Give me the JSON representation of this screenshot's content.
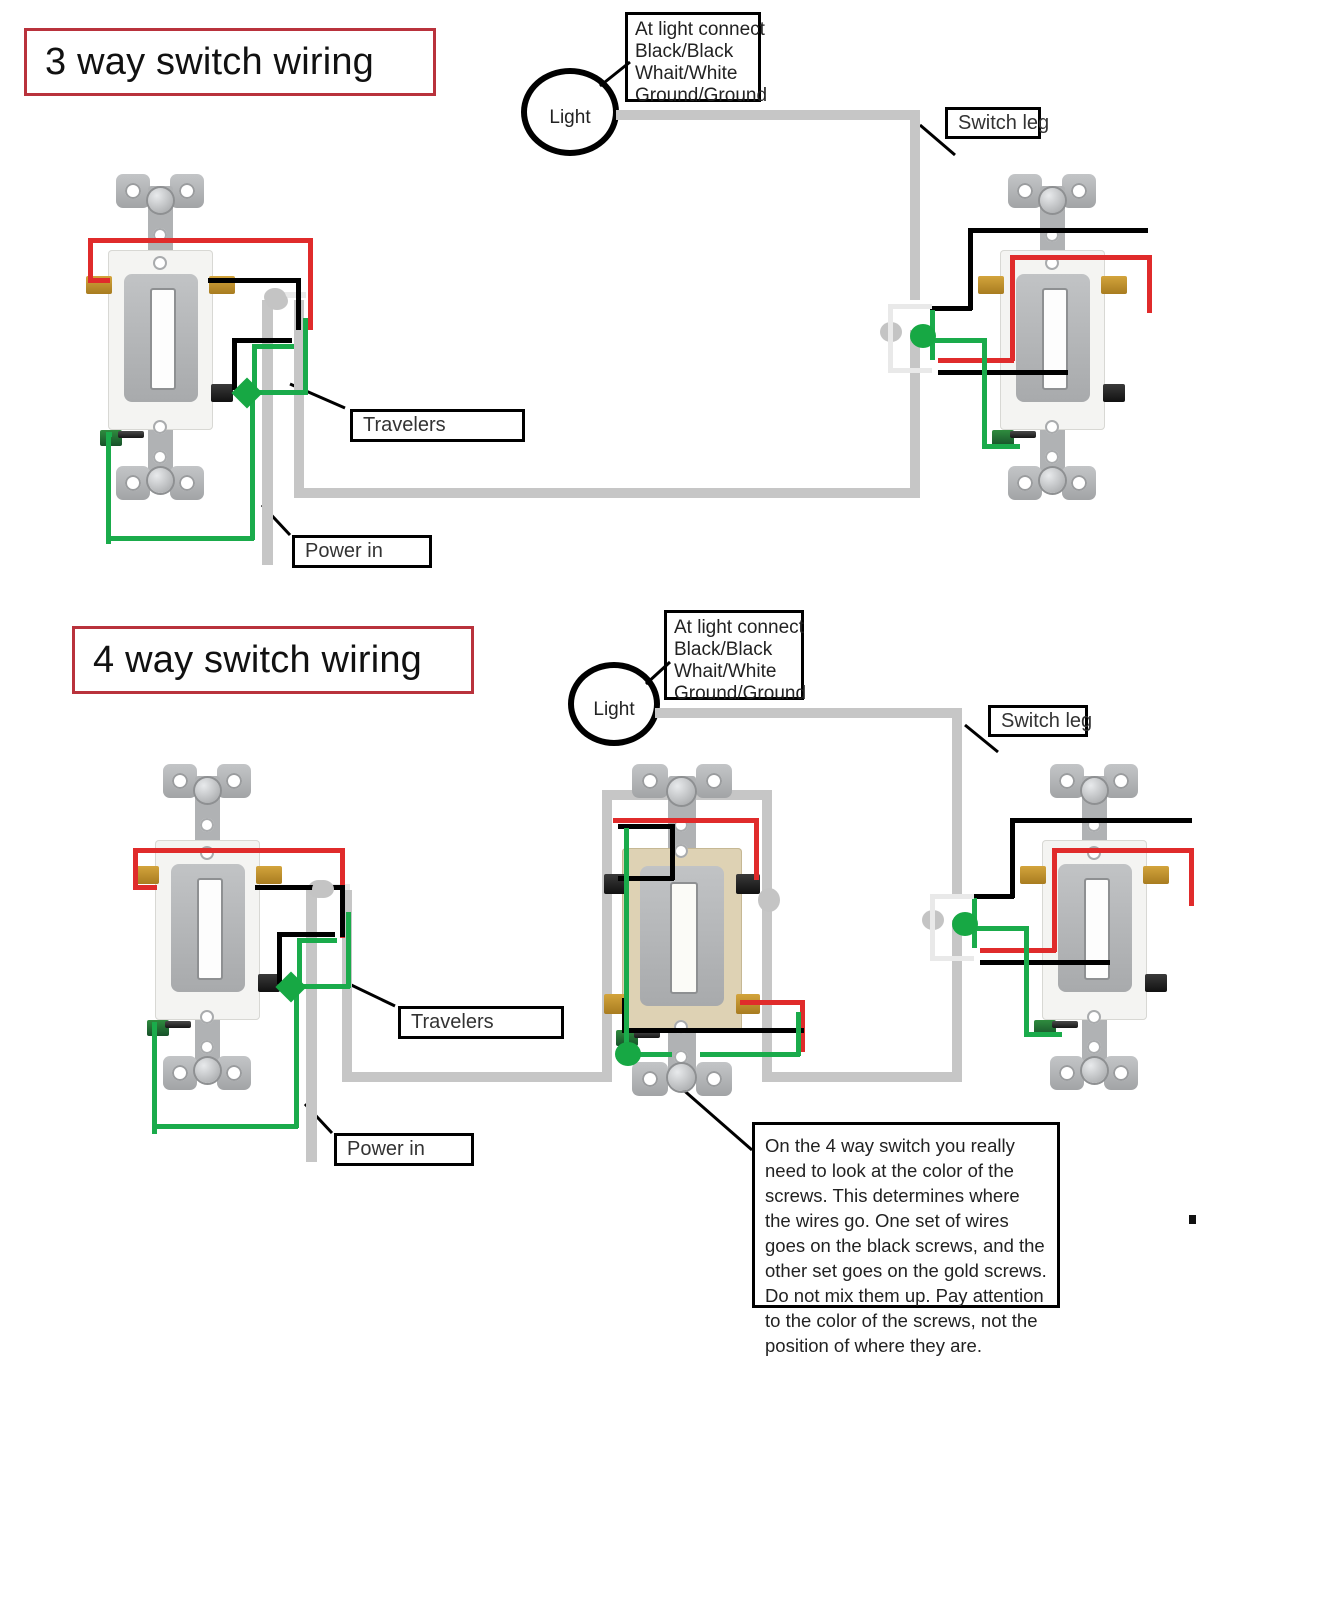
{
  "page": {
    "background": "#ffffff",
    "accent_red": "#b9323c",
    "wire_colors": {
      "hot_black": "#000000",
      "traveler_red": "#e02b2b",
      "ground_green": "#1aab4b",
      "neutral_white": "#e9e9e9",
      "cable_sheath_gray": "#c6c6c6"
    }
  },
  "diagram_three_way": {
    "title": "3 way switch wiring",
    "light": {
      "label": "Light"
    },
    "light_callout": {
      "lines": [
        "At light connect",
        "Black/Black",
        "Whait/White",
        "Ground/Ground"
      ]
    },
    "labels": {
      "switch_leg": "Switch leg",
      "travelers": "Travelers",
      "power_in": "Power in"
    },
    "switches": [
      {
        "name": "left-three-way-switch",
        "body_color": "white"
      },
      {
        "name": "right-three-way-switch",
        "body_color": "white"
      }
    ]
  },
  "diagram_four_way": {
    "title": "4 way switch wiring",
    "light": {
      "label": "Light"
    },
    "light_callout": {
      "lines": [
        "At light connect",
        "Black/Black",
        "Whait/White",
        "Ground/Ground"
      ]
    },
    "labels": {
      "switch_leg": "Switch leg",
      "travelers": "Travelers",
      "power_in": "Power in"
    },
    "switches": [
      {
        "name": "left-four-way-diagram-switch",
        "body_color": "white"
      },
      {
        "name": "center-four-way-switch",
        "body_color": "ivory"
      },
      {
        "name": "right-four-way-diagram-switch",
        "body_color": "white"
      }
    ],
    "note": {
      "text": "On the 4 way switch you really need to look at the color of the screws. This determines where the wires go. One set of wires goes on the black screws, and the other set goes on the gold screws. Do not mix them up. Pay attention to the color of the screws, not the position of where they are."
    }
  }
}
